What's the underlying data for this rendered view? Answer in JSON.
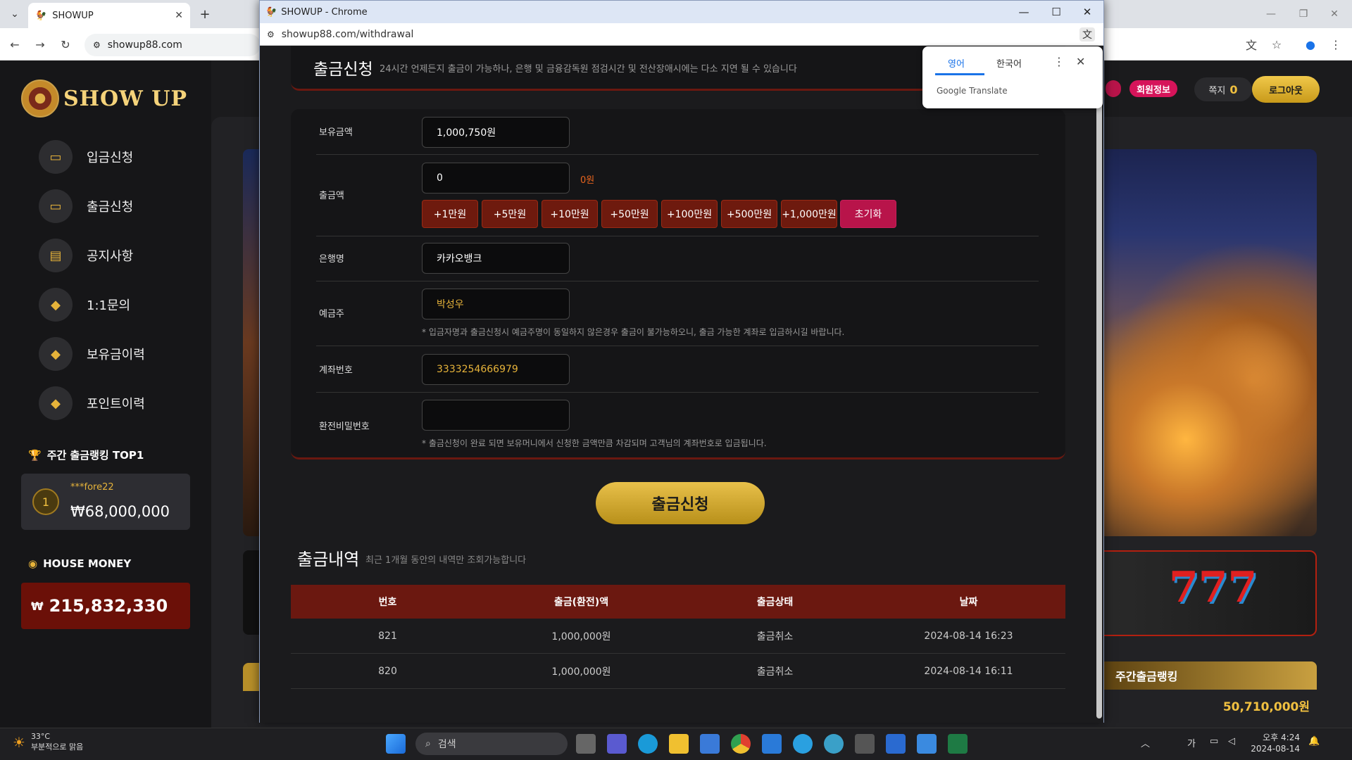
{
  "browser": {
    "tab_title": "SHOWUP",
    "url": "showup88.com"
  },
  "site": {
    "logo": "SHOW UP",
    "menu": [
      {
        "label": "입금신청",
        "icon": "card-icon"
      },
      {
        "label": "출금신청",
        "icon": "card-icon"
      },
      {
        "label": "공지사항",
        "icon": "clipboard-icon"
      },
      {
        "label": "1:1문의",
        "icon": "chat-icon"
      },
      {
        "label": "보유금이력",
        "icon": "chat-icon"
      },
      {
        "label": "포인트이력",
        "icon": "chat-icon"
      }
    ],
    "weekly_rank": {
      "title": "주간 출금랭킹 TOP1",
      "rank": "1",
      "user": "***fore22",
      "amount": "₩68,000,000"
    },
    "house_money": {
      "title": "HOUSE MONEY",
      "currency": "₩",
      "amount": "215,832,330"
    },
    "header": {
      "member_info": "회원정보",
      "note_label": "쪽지",
      "note_count": "0",
      "logout": "로그아웃"
    },
    "rank_strip": {
      "title": "주간출금랭킹",
      "amount": "50,710,000원"
    }
  },
  "popup": {
    "window_title": "SHOWUP - Chrome",
    "url": "showup88.com/withdrawal",
    "header": {
      "title": "출금신청",
      "subtitle": "24시간 언제든지 출금이 가능하나, 은행 및 금융감독원 점검시간 및 전산장애시에는 다소 지연 될 수 있습니다"
    },
    "form": {
      "balance_label": "보유금액",
      "balance": "1,000,750원",
      "amount_label": "출금액",
      "amount_value": "0",
      "amount_display": "0원",
      "amount_buttons": [
        "+1만원",
        "+5만원",
        "+10만원",
        "+50만원",
        "+100만원",
        "+500만원",
        "+1,000만원"
      ],
      "reset_label": "초기화",
      "bank_label": "은행명",
      "bank": "카카오뱅크",
      "holder_label": "예금주",
      "holder": "박성우",
      "holder_note": "* 입금자명과 출금신청시 예금주명이 동일하지 않은경우 출금이 불가능하오니, 출금 가능한 계좌로 입금하시길 바랍니다.",
      "account_label": "계좌번호",
      "account": "3333254666979",
      "password_label": "환전비밀번호",
      "password": "",
      "password_note": "* 출금신청이 완료 되면 보유머니에서 신청한 금액만큼 차감되며 고객님의 계좌번호로 입금됩니다."
    },
    "submit_label": "출금신청",
    "history": {
      "title": "출금내역",
      "subtitle": "최근 1개월 동안의 내역만 조회가능합니다",
      "columns": [
        "번호",
        "출금(환전)액",
        "출금상태",
        "날짜"
      ],
      "rows": [
        {
          "no": "821",
          "amount": "1,000,000원",
          "status": "출금취소",
          "date": "2024-08-14 16:23"
        },
        {
          "no": "820",
          "amount": "1,000,000원",
          "status": "출금취소",
          "date": "2024-08-14 16:11"
        }
      ]
    }
  },
  "translate": {
    "tab_en": "영어",
    "tab_ko": "한국어",
    "brand": "Google Translate"
  },
  "taskbar": {
    "temp": "33°C",
    "weather": "부분적으로 맑음",
    "search_placeholder": "검색",
    "time": "오후 4:24",
    "date": "2024-08-14",
    "ime": "가"
  }
}
